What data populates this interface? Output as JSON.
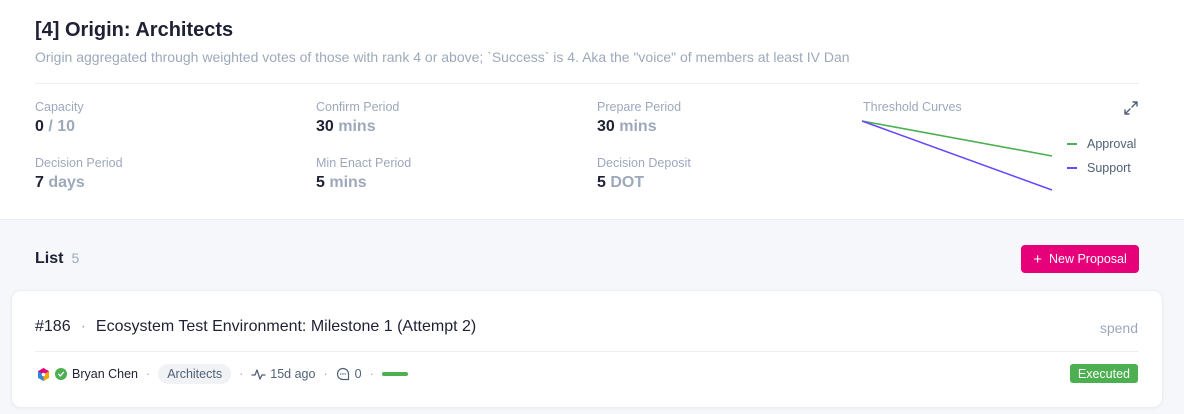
{
  "header": {
    "title": "[4] Origin: Architects",
    "description": "Origin aggregated through weighted votes of those with rank 4 or above; `Success` is 4. Aka the \"voice\" of members at least IV Dan"
  },
  "stats": {
    "capacity": {
      "label": "Capacity",
      "value": "0",
      "unit": "/ 10"
    },
    "confirm_period": {
      "label": "Confirm Period",
      "value": "30",
      "unit": "mins"
    },
    "prepare_period": {
      "label": "Prepare Period",
      "value": "30",
      "unit": "mins"
    },
    "decision_period": {
      "label": "Decision Period",
      "value": "7",
      "unit": "days"
    },
    "min_enact_period": {
      "label": "Min Enact Period",
      "value": "5",
      "unit": "mins"
    },
    "decision_deposit": {
      "label": "Decision Deposit",
      "value": "5",
      "unit": "DOT"
    }
  },
  "threshold_curves": {
    "label": "Threshold Curves",
    "expand_icon": "expand-icon",
    "legend": [
      {
        "name": "Approval",
        "color": "#4caf50"
      },
      {
        "name": "Support",
        "color": "#6848ff"
      }
    ]
  },
  "list": {
    "title": "List",
    "count": "5",
    "new_button_label": "New Proposal",
    "items": [
      {
        "index": "#186",
        "title": "Ecosystem Test Environment: Milestone 1 (Attempt 2)",
        "type": "spend",
        "author": "Bryan Chen",
        "track": "Architects",
        "time": "15d ago",
        "comments": "0",
        "status": "Executed"
      }
    ]
  },
  "colors": {
    "accent": "#e6007a",
    "executed": "#4caf50",
    "approval": "#4caf50",
    "support": "#6848ff"
  }
}
